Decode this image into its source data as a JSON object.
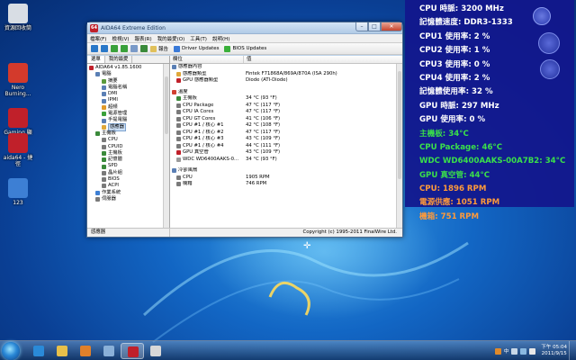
{
  "desktop": {
    "icons": [
      {
        "label": "資源回收筒",
        "color": "#d8dde4"
      },
      {
        "label": "Nero Burning...",
        "color": "#d33a2c"
      },
      {
        "label": "Gaming 顯示卡",
        "color": "#c0202a"
      },
      {
        "label": "aida64 - 捷徑",
        "color": "#c0202a"
      },
      {
        "label": "123",
        "color": "#3d7fd4"
      }
    ]
  },
  "window": {
    "title": "AIDA64 Extreme Edition",
    "controls": {
      "minimize": "–",
      "maximize": "□",
      "close": "✕"
    },
    "menu": [
      "檔案(F)",
      "檢視(V)",
      "報表(R)",
      "我的最愛(O)",
      "工具(T)",
      "說明(H)"
    ],
    "toolbar": {
      "report": "報告",
      "driver_updates": "Driver Updates",
      "bios_updates": "BIOS Updates"
    },
    "left_tabs": [
      "選單",
      "我的最愛"
    ],
    "tree": [
      {
        "label": "AIDA64 v1.85.1600",
        "indent": 0,
        "color": "#c0202a"
      },
      {
        "label": "電腦",
        "indent": 1,
        "color": "#5a7fb5"
      },
      {
        "label": "摘要",
        "indent": 2,
        "color": "#5a9a3c"
      },
      {
        "label": "電腦名稱",
        "indent": 2,
        "color": "#5a7fb5"
      },
      {
        "label": "DMI",
        "indent": 2,
        "color": "#5a7fb5"
      },
      {
        "label": "IPMI",
        "indent": 2,
        "color": "#5a7fb5"
      },
      {
        "label": "超頻",
        "indent": 2,
        "color": "#e09a2a"
      },
      {
        "label": "電源管理",
        "indent": 2,
        "color": "#3aa13a"
      },
      {
        "label": "手提電腦",
        "indent": 2,
        "color": "#5a7fb5"
      },
      {
        "label": "感應器",
        "indent": 2,
        "color": "#e0a83a",
        "selected": true
      },
      {
        "label": "主機板",
        "indent": 1,
        "color": "#3a8a3a"
      },
      {
        "label": "CPU",
        "indent": 2,
        "color": "#7a7a7a"
      },
      {
        "label": "CPUID",
        "indent": 2,
        "color": "#7a7a7a"
      },
      {
        "label": "主機板",
        "indent": 2,
        "color": "#3a8a3a"
      },
      {
        "label": "記憶體",
        "indent": 2,
        "color": "#3a8a3a"
      },
      {
        "label": "SPD",
        "indent": 2,
        "color": "#3a8a3a"
      },
      {
        "label": "晶片組",
        "indent": 2,
        "color": "#7a7a7a"
      },
      {
        "label": "BIOS",
        "indent": 2,
        "color": "#7a7a7a"
      },
      {
        "label": "ACPI",
        "indent": 2,
        "color": "#7a7a7a"
      },
      {
        "label": "作業系統",
        "indent": 1,
        "color": "#3d7fd4"
      },
      {
        "label": "伺服器",
        "indent": 1,
        "color": "#7a7a7a"
      }
    ],
    "columns": {
      "field": "欄位",
      "value": "值"
    },
    "rows": [
      {
        "k": "感應器內容",
        "v": "",
        "type": "sect",
        "color": "#5a7fb5"
      },
      {
        "k": "感應器類型",
        "v": "Fintek F71868A/869A/870A  (ISA 290h)",
        "color": "#e0a83a",
        "indent": true
      },
      {
        "k": "GPU 感應器類型",
        "v": "Diode  (ATI-Diode)",
        "color": "#c0202a",
        "indent": true
      },
      {
        "type": "gap"
      },
      {
        "k": "溫度",
        "v": "",
        "type": "sect",
        "color": "#d04030"
      },
      {
        "k": "主機板",
        "v": "34 °C  (93 °F)",
        "color": "#3a8a3a",
        "indent": true
      },
      {
        "k": "CPU Package",
        "v": "47 °C  (117 °F)",
        "color": "#7a7a7a",
        "indent": true
      },
      {
        "k": "CPU IA Cores",
        "v": "47 °C  (117 °F)",
        "color": "#7a7a7a",
        "indent": true
      },
      {
        "k": "CPU GT Cores",
        "v": "41 °C  (106 °F)",
        "color": "#7a7a7a",
        "indent": true
      },
      {
        "k": "CPU #1 / 核心 #1",
        "v": "42 °C  (108 °F)",
        "color": "#7a7a7a",
        "indent": true
      },
      {
        "k": "CPU #1 / 核心 #2",
        "v": "47 °C  (117 °F)",
        "color": "#7a7a7a",
        "indent": true
      },
      {
        "k": "CPU #1 / 核心 #3",
        "v": "43 °C  (109 °F)",
        "color": "#7a7a7a",
        "indent": true
      },
      {
        "k": "CPU #1 / 核心 #4",
        "v": "44 °C  (111 °F)",
        "color": "#7a7a7a",
        "indent": true
      },
      {
        "k": "GPU 真空管",
        "v": "43 °C  (109 °F)",
        "color": "#c0202a",
        "indent": true
      },
      {
        "k": "WDC WD6400AAKS-0...",
        "v": "34 °C  (93 °F)",
        "color": "#9a9a9a",
        "indent": true
      },
      {
        "type": "gap"
      },
      {
        "k": "冷卻風扇",
        "v": "",
        "type": "sect",
        "color": "#5a7fb5"
      },
      {
        "k": "CPU",
        "v": "1905 RPM",
        "color": "#7a7a7a",
        "indent": true
      },
      {
        "k": "機箱",
        "v": "746 RPM",
        "color": "#7a7a7a",
        "indent": true
      }
    ],
    "status": {
      "left": "感應器",
      "right": "Copyright (c) 1995-2011 FinalWire Ltd."
    }
  },
  "osd": {
    "lines": [
      {
        "text": "CPU 時脈: 3200 MHz",
        "color": "#ffffff"
      },
      {
        "text": "記憶體速度: DDR3-1333",
        "color": "#ffffff"
      },
      {
        "text": "CPU1 使用率: 2 %",
        "color": "#ffffff"
      },
      {
        "text": "CPU2 使用率: 1 %",
        "color": "#ffffff"
      },
      {
        "text": "CPU3 使用率: 0 %",
        "color": "#ffffff"
      },
      {
        "text": "CPU4 使用率: 2 %",
        "color": "#ffffff"
      },
      {
        "text": "記憶體使用率: 32 %",
        "color": "#ffffff"
      },
      {
        "text": "GPU 時脈: 297 MHz",
        "color": "#ffffff"
      },
      {
        "text": "GPU 使用率: 0 %",
        "color": "#ffffff"
      },
      {
        "text": "主機板: 34°C",
        "color": "#3ae04a"
      },
      {
        "text": "CPU Package: 46°C",
        "color": "#3ae04a"
      },
      {
        "text": "WDC WD6400AAKS-00A7B2: 34°C",
        "color": "#3ae04a"
      },
      {
        "text": "GPU 真空管: 44°C",
        "color": "#3ae04a"
      },
      {
        "text": "CPU: 1896 RPM",
        "color": "#ff9a3a"
      },
      {
        "text": "電源供應: 1051 RPM",
        "color": "#ff9a3a"
      },
      {
        "text": "機箱: 751 RPM",
        "color": "#ff9a3a"
      }
    ]
  },
  "taskbar": {
    "buttons": [
      {
        "name": "ie",
        "color": "#2a8ad8"
      },
      {
        "name": "explorer",
        "color": "#e8c04a"
      },
      {
        "name": "media-player",
        "color": "#e0802a"
      },
      {
        "name": "network",
        "color": "#8ab0d8"
      },
      {
        "name": "aida64",
        "color": "#c0202a",
        "active": true
      },
      {
        "name": "tool",
        "color": "#d8d8d8"
      }
    ],
    "tray_lang": "中",
    "time": "下午 05:04",
    "date": "2011/9/15"
  }
}
